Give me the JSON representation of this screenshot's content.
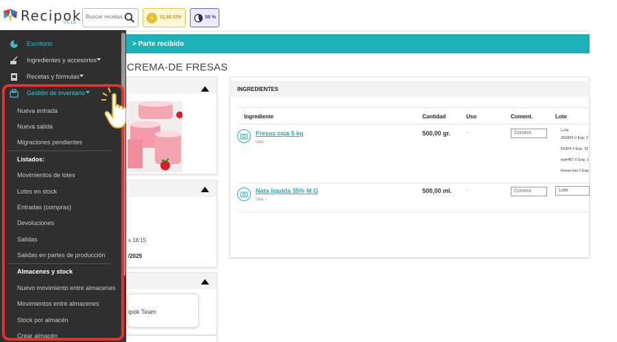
{
  "app": {
    "name": "Recipok",
    "version": "V4.19"
  },
  "topbar": {
    "search_placeholder": "Buscar recetas...",
    "price_label": "31,60 €/hr",
    "percent_label": "58 %"
  },
  "sidebar": {
    "items": [
      {
        "label": "Escritorio",
        "icon": "pie-chart-icon"
      },
      {
        "label": "Ingredientes y accesorios",
        "icon": "mixer-icon"
      },
      {
        "label": "Recetas y fórmulas",
        "icon": "recipe-book-icon"
      },
      {
        "label": "Gestión de inventario",
        "icon": "inventory-icon"
      }
    ],
    "inventory_sub": {
      "nueva_entrada": "Nueva entrada",
      "nueva_salida": "Nueva salida",
      "migraciones": "Migraciones pendientes",
      "listados_head": "Listados:",
      "movimientos_lotes": "Movimientos de lotes",
      "lotes_stock": "Lotes en stock",
      "entradas": "Entradas (compras)",
      "devoluciones": "Devoluciones",
      "salidas": "Salidas",
      "salidas_partes": "Salidas en partes de producción",
      "almacenes_head": "Almacenes y stock",
      "nuevo_mov_almacen": "Nuevo movimiento entre almacenes",
      "mov_almacenes": "Movimientos entre almacenes",
      "stock_almacen": "Stock por almacén",
      "crear_almacen": "Crear almacén"
    }
  },
  "main": {
    "banner": "> Parte recibido",
    "title": "CREMA-DE FRESAS",
    "meta_time": "s 18:15",
    "meta_date": "/2025",
    "team": "ipok Team"
  },
  "ingredients": {
    "header": "INGREDIENTES",
    "columns": {
      "ingrediente": "Ingrediente",
      "cantidad": "Cantidad",
      "uso": "Uso",
      "coment": "Coment.",
      "lote": "Lote"
    },
    "rows": [
      {
        "name": "Fresas caja 5 kg",
        "uso": "Uso: -",
        "qty": "500,00 gr.",
        "uso_value": "-",
        "coment_placeholder": "Coment."
      },
      {
        "name": "Nata líquida 35% M.G",
        "uso": "Uso: -",
        "qty": "500,00 ml.",
        "uso_value": "-",
        "coment_placeholder": "Coment."
      }
    ],
    "lote_options_title": "Lote",
    "lote_options": [
      "254363 // Exp. 2",
      "54324 // Exp. 31",
      "wytr457 // Exp. 1",
      "fresas luis // Exp."
    ],
    "lote_select_value": "Lote"
  },
  "colors": {
    "accent": "#1eb1b7",
    "sidebar_bg": "#2f2f2f",
    "highlight_frame": "#e5322d"
  }
}
